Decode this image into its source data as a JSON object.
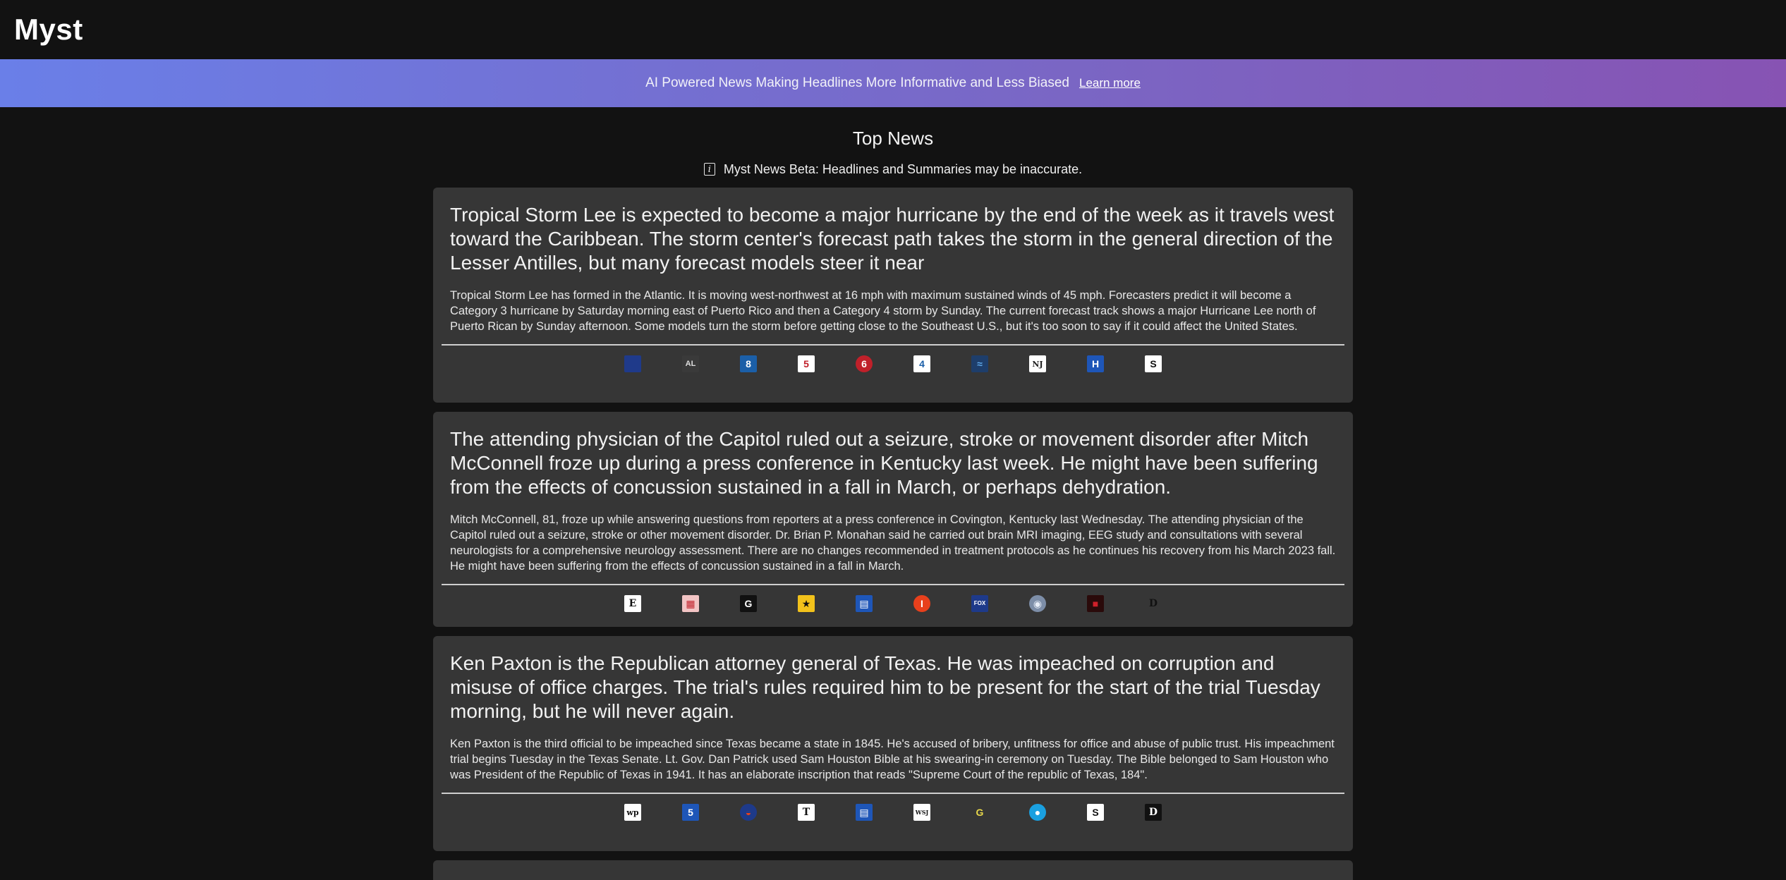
{
  "app": {
    "title": "Myst"
  },
  "banner": {
    "text": "AI Powered News Making Headlines More Informative and Less Biased",
    "link_label": "Learn more"
  },
  "page": {
    "section_title": "Top News",
    "disclaimer": "Myst News Beta: Headlines and Summaries may be inaccurate."
  },
  "colors": {
    "background": "#121212",
    "card": "#363636",
    "banner_start": "#6a7fe8",
    "banner_end": "#8753b3"
  },
  "articles": [
    {
      "headline": "Tropical Storm Lee is expected to become a major hurricane by the end of the week as it travels west toward the Caribbean. The storm center's forecast path takes the storm in the general direction of the Lesser Antilles, but many forecast models steer it near",
      "summary": "Tropical Storm Lee has formed in the Atlantic. It is moving west-northwest at 16 mph with maximum sustained winds of 45 mph. Forecasters predict it will become a Category 3 hurricane by Saturday morning east of Puerto Rico and then a Category 4 storm by Sunday. The current forecast track shows a major Hurricane Lee north of Puerto Rican by Sunday afternoon. Some models turn the storm before getting close to the Southeast U.S., but it's too soon to say if it could affect the United States.",
      "sources": [
        {
          "icon": "news-logo-blue-icon",
          "glyph": "",
          "bg": "#1f3a8a",
          "fg": "#ffffff"
        },
        {
          "icon": "news-logo-al-icon",
          "glyph": "AL",
          "bg": "#3a3a3a",
          "fg": "#dddddd"
        },
        {
          "icon": "channel-8-icon",
          "glyph": "8",
          "bg": "#1b5fa8",
          "fg": "#ffffff"
        },
        {
          "icon": "channel-5-icon",
          "glyph": "5",
          "bg": "#ffffff",
          "fg": "#c0202a"
        },
        {
          "icon": "channel-6-icon",
          "glyph": "6",
          "bg": "#c0202a",
          "fg": "#ffffff"
        },
        {
          "icon": "channel-4-icon",
          "glyph": "4",
          "bg": "#ffffff",
          "fg": "#1b5fa8"
        },
        {
          "icon": "news-logo-waves-icon",
          "glyph": "≈",
          "bg": "#1e3e6b",
          "fg": "#5fa8e8"
        },
        {
          "icon": "news-logo-nj-icon",
          "glyph": "NJ",
          "bg": "#ffffff",
          "fg": "#222222"
        },
        {
          "icon": "news-logo-h-icon",
          "glyph": "H",
          "bg": "#1e56b8",
          "fg": "#ffffff"
        },
        {
          "icon": "news-logo-s-icon",
          "glyph": "S",
          "bg": "#ffffff",
          "fg": "#111111"
        }
      ]
    },
    {
      "headline": "The attending physician of the Capitol ruled out a seizure, stroke or movement disorder after Mitch McConnell froze up during a press conference in Kentucky last week. He might have been suffering from the effects of concussion sustained in a fall in March, or perhaps dehydration.",
      "summary": "Mitch McConnell, 81, froze up while answering questions from reporters at a press conference in Covington, Kentucky last Wednesday. The attending physician of the Capitol ruled out a seizure, stroke or other movement disorder. Dr. Brian P. Monahan said he carried out brain MRI imaging, EEG study and consultations with several neurologists for a comprehensive neurology assessment. There are no changes recommended in treatment protocols as he continues his recovery from his March 2023 fall. He might have been suffering from the effects of concussion sustained in a fall in March.",
      "sources": [
        {
          "icon": "news-logo-e-icon",
          "glyph": "E",
          "bg": "#ffffff",
          "fg": "#111111"
        },
        {
          "icon": "news-logo-red-grid-icon",
          "glyph": "▦",
          "bg": "#f2c4c4",
          "fg": "#c0202a"
        },
        {
          "icon": "news-logo-g-icon",
          "glyph": "G",
          "bg": "#111111",
          "fg": "#ffffff"
        },
        {
          "icon": "news-logo-star-icon",
          "glyph": "★",
          "bg": "#f2c21b",
          "fg": "#111111"
        },
        {
          "icon": "news-logo-blue-box-icon",
          "glyph": "▤",
          "bg": "#1e56b8",
          "fg": "#ffffff"
        },
        {
          "icon": "news-logo-i-icon",
          "glyph": "I",
          "bg": "#e8401c",
          "fg": "#ffffff"
        },
        {
          "icon": "fox-news-icon",
          "glyph": "FOX",
          "bg": "#1e3a8a",
          "fg": "#ffffff"
        },
        {
          "icon": "globe-icon",
          "glyph": "◉",
          "bg": "#7d8ea8",
          "fg": "#e8eef8"
        },
        {
          "icon": "news-logo-red-dark-icon",
          "glyph": "■",
          "bg": "#2a0a0a",
          "fg": "#d0202a"
        },
        {
          "icon": "news-logo-d-icon",
          "glyph": "D",
          "bg": "#363636",
          "fg": "#111111"
        }
      ]
    },
    {
      "headline": "Ken Paxton is the Republican attorney general of Texas. He was impeached on corruption and misuse of office charges. The trial's rules required him to be present for the start of the trial Tuesday morning, but he will never again.",
      "summary": "Ken Paxton is the third official to be impeached since Texas became a state in 1845. He's accused of bribery, unfitness for office and abuse of public trust. His impeachment trial begins Tuesday in the Texas Senate. Lt. Gov. Dan Patrick used Sam Houston Bible at his swearing-in ceremony on Tuesday. The Bible belonged to Sam Houston who was President of the Republic of Texas in 1941. It has an elaborate inscription that reads \"Supreme Court of the republic of Texas, 184\".",
      "sources": [
        {
          "icon": "washington-post-icon",
          "glyph": "wp",
          "bg": "#ffffff",
          "fg": "#111111"
        },
        {
          "icon": "channel-5-blue-icon",
          "glyph": "5",
          "bg": "#1e56b8",
          "fg": "#ffffff"
        },
        {
          "icon": "news-logo-peacock-icon",
          "glyph": "◒",
          "bg": "#1e3a8a",
          "fg": "#e8401c"
        },
        {
          "icon": "news-logo-t-icon",
          "glyph": "T",
          "bg": "#ffffff",
          "fg": "#111111"
        },
        {
          "icon": "news-logo-blue-box-icon",
          "glyph": "▤",
          "bg": "#1e56b8",
          "fg": "#ffffff"
        },
        {
          "icon": "wsj-icon",
          "glyph": "WSJ",
          "bg": "#ffffff",
          "fg": "#111111"
        },
        {
          "icon": "news-logo-yellow-g-icon",
          "glyph": "G",
          "bg": "#363636",
          "fg": "#e8d84a"
        },
        {
          "icon": "news-logo-cyan-icon",
          "glyph": "●",
          "bg": "#1aa0e0",
          "fg": "#ffffff"
        },
        {
          "icon": "news-logo-s-icon",
          "glyph": "S",
          "bg": "#ffffff",
          "fg": "#111111"
        },
        {
          "icon": "news-logo-d-dark-icon",
          "glyph": "D",
          "bg": "#111111",
          "fg": "#ffffff"
        }
      ]
    }
  ]
}
